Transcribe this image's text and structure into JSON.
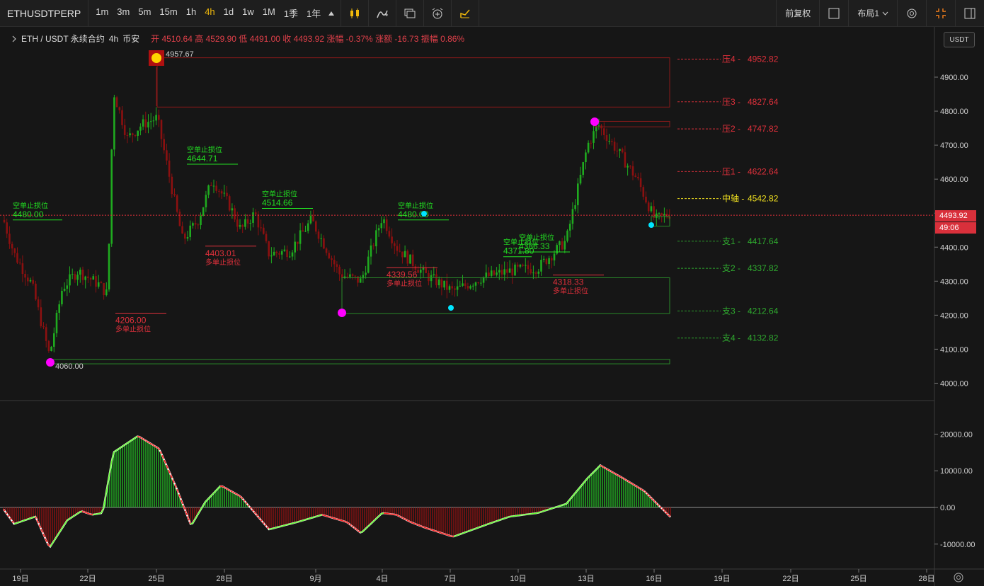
{
  "toolbar": {
    "symbol": "ETHUSDTPERP",
    "timeframes": [
      "1m",
      "3m",
      "5m",
      "15m",
      "1h",
      "4h",
      "1d",
      "1w",
      "1M",
      "1季",
      "1年"
    ],
    "active_timeframe": "4h",
    "adjust_label": "前复权",
    "layout_label": "布局1"
  },
  "header": {
    "title": "ETH / USDT 永续合约",
    "interval": "4h",
    "exchange": "币安",
    "ohlc": "开 4510.64 高 4529.90 低 4491.00 收 4493.92 涨幅 -0.37% 涨额 -16.73 振幅 0.86%"
  },
  "currency_label": "USDT",
  "current_price": "4493.92",
  "countdown": "49:06",
  "price_axis": [
    "4900.00",
    "4800.00",
    "4700.00",
    "4600.00",
    "4500.00",
    "4400.00",
    "4300.00",
    "4200.00",
    "4100.00",
    "4000.00"
  ],
  "osc_axis": [
    "20000.00",
    "10000.00",
    "0.00",
    "-10000.00"
  ],
  "date_axis": [
    "19日",
    "22日",
    "25日",
    "28日",
    "9月",
    "4日",
    "7日",
    "10日",
    "13日",
    "16日",
    "19日",
    "22日",
    "25日",
    "28日"
  ],
  "levels": [
    {
      "label": "压4 -",
      "value": "4952.82",
      "color": "#e0303b"
    },
    {
      "label": "压3 -",
      "value": "4827.64",
      "color": "#e0303b"
    },
    {
      "label": "压2 -",
      "value": "4747.82",
      "color": "#e0303b"
    },
    {
      "label": "压1 -",
      "value": "4622.64",
      "color": "#e0303b"
    },
    {
      "label": "中轴 -",
      "value": "4542.82",
      "color": "#f0e020"
    },
    {
      "label": "支1 -",
      "value": "4417.64",
      "color": "#2faa2f"
    },
    {
      "label": "支2 -",
      "value": "4337.82",
      "color": "#2faa2f"
    },
    {
      "label": "支3 -",
      "value": "4212.64",
      "color": "#2faa2f"
    },
    {
      "label": "支4 -",
      "value": "4132.82",
      "color": "#2faa2f"
    }
  ],
  "stop_labels": [
    {
      "title": "空单止损位",
      "value": "4480.00",
      "kind": "short"
    },
    {
      "title": "空单止损位",
      "value": "4644.71",
      "kind": "short"
    },
    {
      "title": "空单止损位",
      "value": "4514.66",
      "kind": "short"
    },
    {
      "title": "空单止损位",
      "value": "4480.00",
      "kind": "short"
    },
    {
      "title": "空单止损位",
      "value": "4371.80",
      "kind": "short"
    },
    {
      "title": "空单止损位",
      "value": "4386.33",
      "kind": "short"
    },
    {
      "title": "多单止损位",
      "value": "4206.00",
      "kind": "long"
    },
    {
      "title": "多单止损位",
      "value": "4403.01",
      "kind": "long"
    },
    {
      "title": "多单止损位",
      "value": "4339.56",
      "kind": "long"
    },
    {
      "title": "多单止损位",
      "value": "4318.33",
      "kind": "long"
    }
  ],
  "markers": [
    {
      "label": "4957.67"
    },
    {
      "label": "4060.00"
    }
  ],
  "colors": {
    "up": "#1faa1f",
    "down": "#8b1010",
    "resistance": "#e0303b",
    "support": "#2faa2f",
    "pivot": "#f0e020",
    "magenta": "#ff00ff",
    "cyan": "#00e5ff"
  },
  "icons": [
    "candle-icon",
    "indicator-icon",
    "compare-icon",
    "alarm-icon",
    "draw-icon",
    "fullscreen-icon",
    "settings-icon",
    "collapse-icon",
    "panel-icon",
    "chevron-right-icon",
    "triangle-down-icon",
    "gear-icon"
  ]
}
